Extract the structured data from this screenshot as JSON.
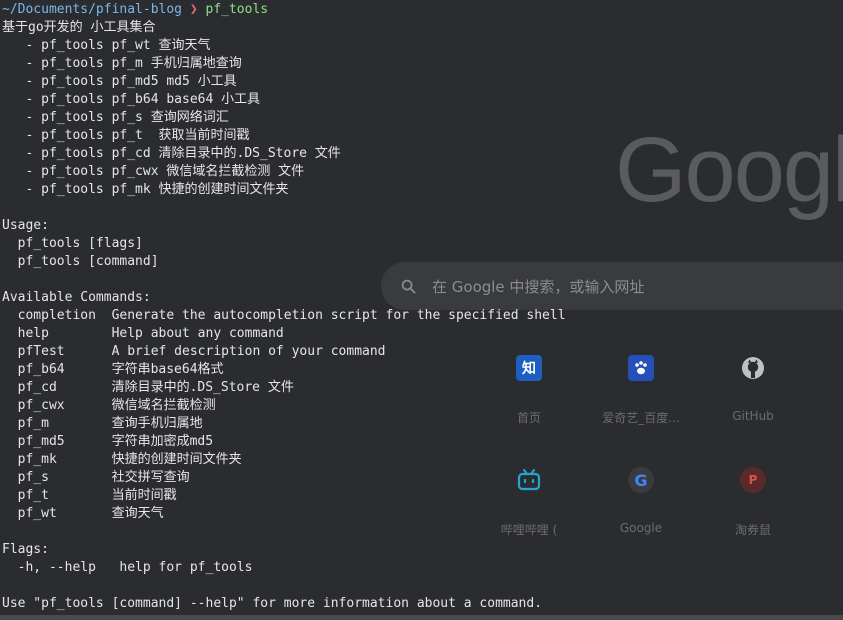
{
  "prompt": {
    "path": "~/Documents/pfinal-blog",
    "separator": "❯",
    "command": "pf_tools"
  },
  "output_lines": [
    "基于go开发的 小工具集合",
    "   - pf_tools pf_wt 查询天气",
    "   - pf_tools pf_m 手机归属地查询",
    "   - pf_tools pf_md5 md5 小工具",
    "   - pf_tools pf_b64 base64 小工具",
    "   - pf_tools pf_s 查询网络词汇",
    "   - pf_tools pf_t  获取当前时间戳",
    "   - pf_tools pf_cd 清除目录中的.DS_Store 文件",
    "   - pf_tools pf_cwx 微信域名拦截检测 文件",
    "   - pf_tools pf_mk 快捷的创建时间文件夹",
    "",
    "Usage:",
    "  pf_tools [flags]",
    "  pf_tools [command]",
    "",
    "Available Commands:",
    "  completion  Generate the autocompletion script for the specified shell",
    "  help        Help about any command",
    "  pfTest      A brief description of your command",
    "  pf_b64      字符串base64格式",
    "  pf_cd       清除目录中的.DS_Store 文件",
    "  pf_cwx      微信域名拦截检测",
    "  pf_m        查询手机归属地",
    "  pf_md5      字符串加密成md5",
    "  pf_mk       快捷的创建时间文件夹",
    "  pf_s        社交拼写查询",
    "  pf_t        当前时间戳",
    "  pf_wt       查询天气",
    "",
    "Flags:",
    "  -h, --help   help for pf_tools",
    "",
    "Use \"pf_tools [command] --help\" for more information about a command."
  ],
  "background": {
    "google_logo_text": "Googl",
    "search_placeholder": "在 Google 中搜索，或输入网址",
    "shortcuts": [
      {
        "icon": "zhihu-icon",
        "glyph": "知",
        "color": "#1772f6",
        "label": "首页"
      },
      {
        "icon": "baidu-paw-icon",
        "glyph": "",
        "color": "#2d6ae0",
        "label": "爱奇艺_百度..."
      },
      {
        "icon": "github-icon",
        "glyph": "",
        "color": "#d0d0d0",
        "label": "GitHub"
      },
      {
        "icon": "bilibili-icon",
        "glyph": "",
        "color": "#23a6d5",
        "label": "哔哩哔哩 ("
      },
      {
        "icon": "google-g-icon",
        "glyph": "G",
        "color": "#4285f4",
        "label": "Google"
      },
      {
        "icon": "taoquanshu-icon",
        "glyph": "P",
        "color": "#c0392b",
        "label": "淘券鼠"
      }
    ]
  }
}
